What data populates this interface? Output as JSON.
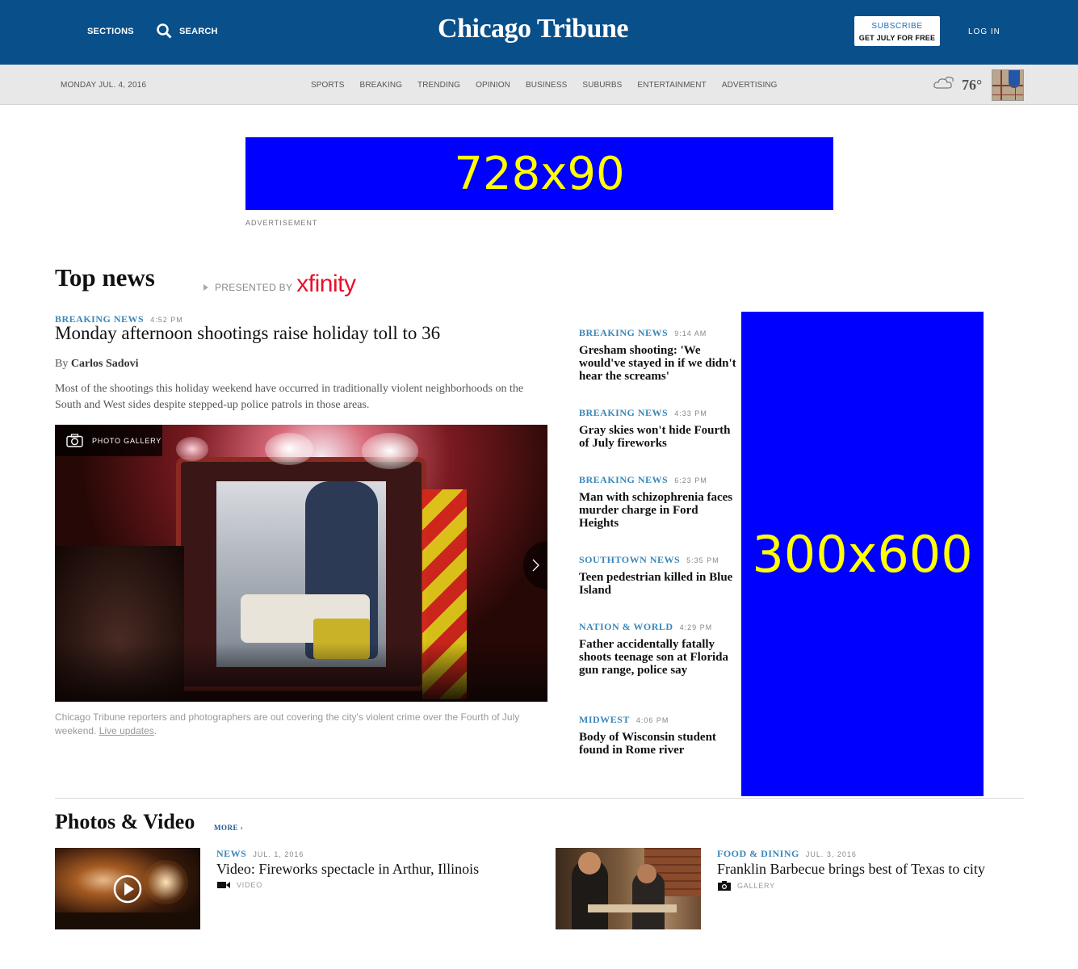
{
  "header": {
    "sections_label": "SECTIONS",
    "search_label": "SEARCH",
    "logo_text": "Chicago Tribune",
    "subscribe_line1": "SUBSCRIBE",
    "subscribe_line2": "GET JULY FOR FREE",
    "login_label": "LOG IN"
  },
  "subnav": {
    "date": "MONDAY JUL. 4, 2016",
    "links": [
      "SPORTS",
      "BREAKING",
      "TRENDING",
      "OPINION",
      "BUSINESS",
      "SUBURBS",
      "ENTERTAINMENT",
      "ADVERTISING"
    ],
    "weather_icon": "cloudy-icon",
    "temperature": "76°"
  },
  "ads": {
    "top_label": "728x90",
    "top_caption": "ADVERTISEMENT",
    "side_label": "300x600"
  },
  "top_news": {
    "heading": "Top news",
    "presented_by": "PRESENTED BY",
    "sponsor": "xfinity",
    "lead": {
      "kicker": "BREAKING NEWS",
      "time": "4:52 PM",
      "title": "Monday afternoon shootings raise holiday toll to 36",
      "byline_prefix": "By",
      "author": "Carlos Sadovi",
      "summary": "Most of the shootings this holiday weekend have occurred in traditionally violent neighborhoods on the South and West sides despite stepped-up police patrols in those areas.",
      "gallery_label": "PHOTO GALLERY",
      "caption": "Chicago Tribune reporters and photographers are out covering the city's violent crime over the Fourth of July weekend.",
      "caption_link": "Live updates",
      "caption_end": "."
    },
    "headlines": [
      {
        "kicker": "BREAKING NEWS",
        "time": "9:14 AM",
        "title": "Gresham shooting: 'We would've stayed in if we didn't hear the screams'"
      },
      {
        "kicker": "BREAKING NEWS",
        "time": "4:33 PM",
        "title": "Gray skies won't hide Fourth of July fireworks"
      },
      {
        "kicker": "BREAKING NEWS",
        "time": "6:23 PM",
        "title": "Man with schizophrenia faces murder charge in Ford Heights"
      },
      {
        "kicker": "SOUTHTOWN NEWS",
        "time": "5:35 PM",
        "title": "Teen pedestrian killed in Blue Island"
      },
      {
        "kicker": "NATION & WORLD",
        "time": "4:29 PM",
        "title": "Father accidentally fatally shoots teenage son at Florida gun range, police say"
      },
      {
        "kicker": "MIDWEST",
        "time": "4:06 PM",
        "title": "Body of Wisconsin student found in Rome river"
      }
    ]
  },
  "photos_video": {
    "heading": "Photos & Video",
    "more_label": "MORE ›",
    "items": [
      {
        "kicker": "NEWS",
        "date": "JUL. 1, 2016",
        "title": "Video: Fireworks spectacle in Arthur, Illinois",
        "type": "VIDEO",
        "type_icon": "video-camera-icon"
      },
      {
        "kicker": "FOOD & DINING",
        "date": "JUL. 3, 2016",
        "title": "Franklin Barbecue brings best of Texas to city",
        "type": "GALLERY",
        "type_icon": "camera-icon"
      }
    ]
  }
}
